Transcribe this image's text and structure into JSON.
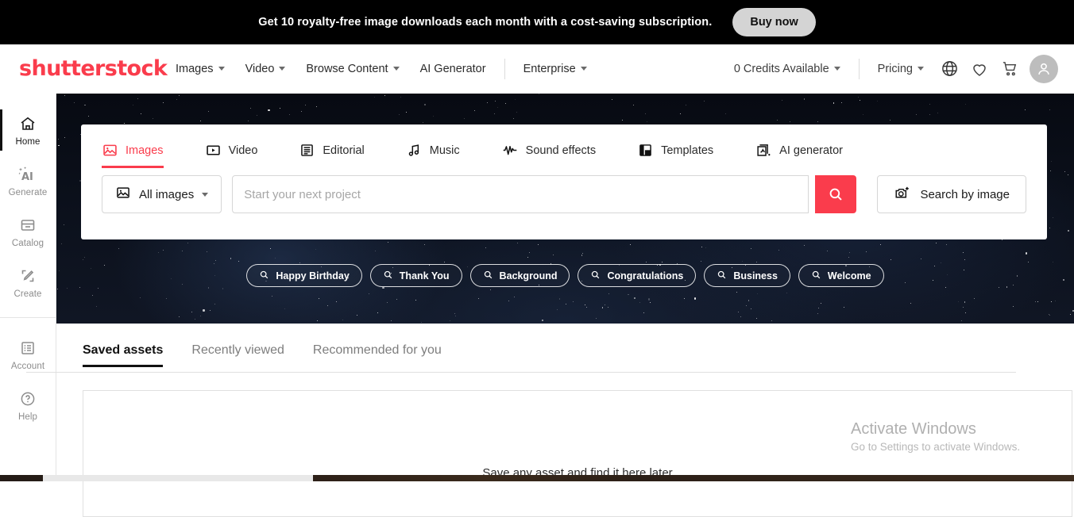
{
  "promo": {
    "text": "Get 10 royalty-free image downloads each month with a cost-saving subscription.",
    "cta_label": "Buy now"
  },
  "brand": {
    "logo_text": "shutterstock",
    "accent_color": "#fa3c4c"
  },
  "topnav": {
    "links": [
      {
        "label": "Images",
        "has_caret": true
      },
      {
        "label": "Video",
        "has_caret": true
      },
      {
        "label": "Browse Content",
        "has_caret": true
      },
      {
        "label": "AI Generator",
        "has_caret": false
      },
      {
        "label": "Enterprise",
        "has_caret": true
      }
    ],
    "credits_label": "0 Credits Available",
    "pricing_label": "Pricing",
    "icons": [
      {
        "name": "globe-icon"
      },
      {
        "name": "heart-icon"
      },
      {
        "name": "cart-icon"
      },
      {
        "name": "avatar-icon"
      }
    ]
  },
  "sidebar": {
    "primary": [
      {
        "label": "Home",
        "icon": "home-icon",
        "active": true
      },
      {
        "label": "Generate",
        "icon": "ai-sparkle-icon",
        "active": false
      },
      {
        "label": "Catalog",
        "icon": "catalog-icon",
        "active": false
      },
      {
        "label": "Create",
        "icon": "pencil-crop-icon",
        "active": false
      }
    ],
    "secondary": [
      {
        "label": "Account",
        "icon": "account-list-icon",
        "active": false
      },
      {
        "label": "Help",
        "icon": "help-circle-icon",
        "active": false
      }
    ]
  },
  "search": {
    "tabs": [
      {
        "label": "Images",
        "icon": "image-icon",
        "active": true
      },
      {
        "label": "Video",
        "icon": "video-play-icon",
        "active": false
      },
      {
        "label": "Editorial",
        "icon": "editorial-doc-icon",
        "active": false
      },
      {
        "label": "Music",
        "icon": "music-note-icon",
        "active": false
      },
      {
        "label": "Sound effects",
        "icon": "waveform-icon",
        "active": false
      },
      {
        "label": "Templates",
        "icon": "templates-layout-icon",
        "active": false
      },
      {
        "label": "AI generator",
        "icon": "ai-generator-icon",
        "active": false
      }
    ],
    "dropdown_label": "All images",
    "dropdown_icon": "image-icon",
    "placeholder": "Start your next project",
    "value": "",
    "go_icon": "search-icon",
    "search_by_image_label": "Search by image",
    "search_by_image_icon": "camera-plus-icon"
  },
  "chips": [
    {
      "label": "Happy Birthday",
      "icon": "search-icon"
    },
    {
      "label": "Thank You",
      "icon": "search-icon"
    },
    {
      "label": "Background",
      "icon": "search-icon"
    },
    {
      "label": "Congratulations",
      "icon": "search-icon"
    },
    {
      "label": "Business",
      "icon": "search-icon"
    },
    {
      "label": "Welcome",
      "icon": "search-icon"
    }
  ],
  "content": {
    "tabs": [
      {
        "label": "Saved assets",
        "active": true
      },
      {
        "label": "Recently viewed",
        "active": false
      },
      {
        "label": "Recommended for you",
        "active": false
      }
    ],
    "empty_message": "Save any asset and find it here later"
  },
  "watermark": {
    "title": "Activate Windows",
    "subtitle": "Go to Settings to activate Windows."
  }
}
